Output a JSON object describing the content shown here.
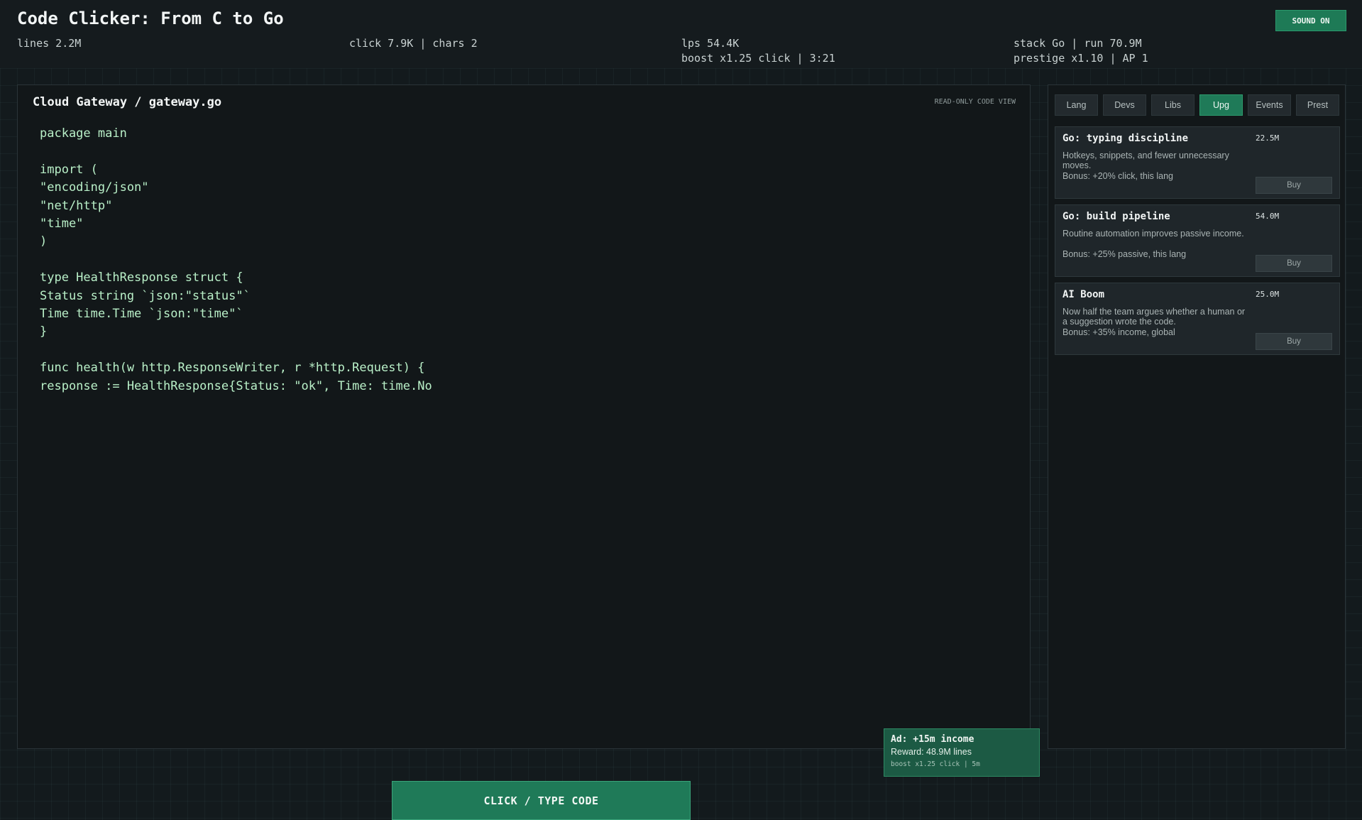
{
  "header": {
    "title": "Code Clicker: From C to Go",
    "sound_label": "SOUND ON",
    "stats": {
      "lines": "lines 2.2M",
      "click": "click 7.9K | chars 2",
      "lps": "lps 54.4K",
      "boost": "boost x1.25 click | 3:21",
      "stack": "stack Go | run 70.9M",
      "prestige": "prestige x1.10 | AP 1"
    }
  },
  "code_panel": {
    "title": "Cloud Gateway / gateway.go",
    "readonly_label": "READ-ONLY CODE VIEW",
    "code": "package main\n\nimport (\n\"encoding/json\"\n\"net/http\"\n\"time\"\n)\n\ntype HealthResponse struct {\nStatus string `json:\"status\"`\nTime time.Time `json:\"time\"`\n}\n\nfunc health(w http.ResponseWriter, r *http.Request) {\nresponse := HealthResponse{Status: \"ok\", Time: time.No"
  },
  "ad": {
    "title": "Ad: +15m income",
    "reward": "Reward: 48.9M lines",
    "subtitle": "boost x1.25 click | 5m"
  },
  "click_button_label": "CLICK / TYPE CODE",
  "tabs": [
    {
      "label": "Lang"
    },
    {
      "label": "Devs"
    },
    {
      "label": "Libs"
    },
    {
      "label": "Upg"
    },
    {
      "label": "Events"
    },
    {
      "label": "Prest"
    }
  ],
  "active_tab": "Upg",
  "upgrades": [
    {
      "name": "Go: typing discipline",
      "cost": "22.5M",
      "description": "Hotkeys, snippets, and fewer unnecessary moves.",
      "bonus": "Bonus: +20% click, this lang",
      "buy_label": "Buy"
    },
    {
      "name": "Go: build pipeline",
      "cost": "54.0M",
      "description": "Routine automation improves passive income.",
      "bonus": "Bonus: +25% passive, this lang",
      "buy_label": "Buy"
    },
    {
      "name": "AI Boom",
      "cost": "25.0M",
      "description": "Now half the team argues whether a human or a suggestion wrote the code.",
      "bonus": "Bonus: +35% income, global",
      "buy_label": "Buy"
    }
  ],
  "colors": {
    "accent": "#1f7a58",
    "background": "#131a1d",
    "code_text": "#b9f0c8"
  }
}
